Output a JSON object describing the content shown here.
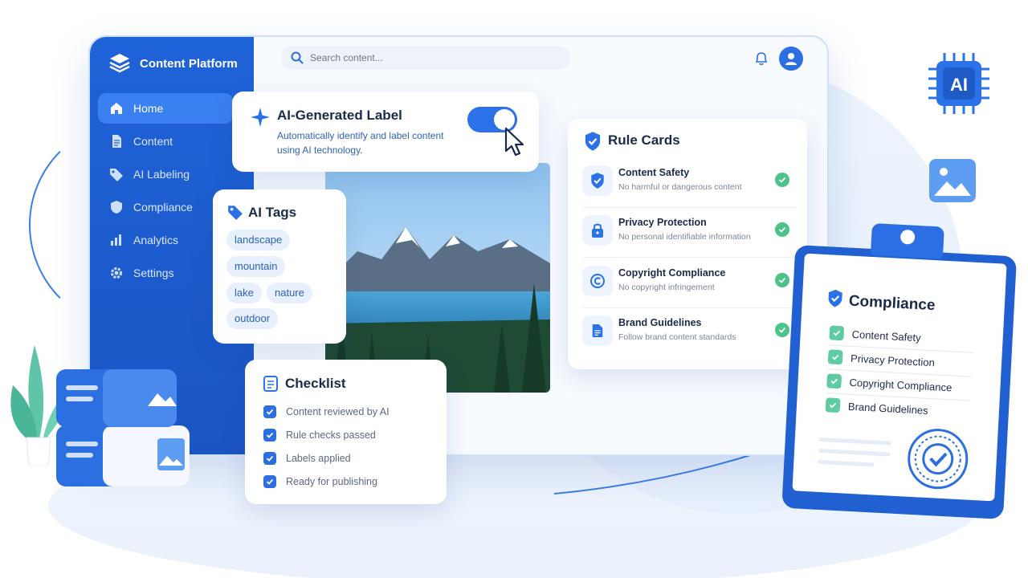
{
  "colors": {
    "primary": "#1f63d8",
    "accent": "#2b72e8",
    "success": "#4bc38a",
    "checklist_green": "#5fcba1"
  },
  "app": {
    "title": "Content Platform",
    "logo_icon": "layers-icon"
  },
  "search": {
    "placeholder": "Search content...",
    "icon": "search-icon"
  },
  "sidebar": {
    "items": [
      {
        "label": "Home",
        "icon": "home-icon",
        "active": true
      },
      {
        "label": "Content",
        "icon": "document-icon",
        "active": false
      },
      {
        "label": "AI Labeling",
        "icon": "tag-icon",
        "active": false
      },
      {
        "label": "Compliance",
        "icon": "shield-icon",
        "active": false
      },
      {
        "label": "Analytics",
        "icon": "bar-chart-icon",
        "active": false
      },
      {
        "label": "Settings",
        "icon": "gear-icon",
        "active": false
      }
    ]
  },
  "ai_label": {
    "title": "AI-Generated Label",
    "description": "Automatically identify and label content using AI technology.",
    "toggle_on": true
  },
  "ai_tags": {
    "title": "AI Tags",
    "tags": [
      "landscape",
      "mountain",
      "lake",
      "nature",
      "outdoor"
    ]
  },
  "checklist": {
    "title": "Checklist",
    "items": [
      "Content reviewed by AI",
      "Rule checks passed",
      "Labels applied",
      "Ready for publishing"
    ]
  },
  "rule_cards": {
    "title": "Rule Cards",
    "rules": [
      {
        "name": "Content Safety",
        "desc": "No harmful or dangerous content",
        "icon": "shield-check-icon"
      },
      {
        "name": "Privacy Protection",
        "desc": "No personal identifiable information",
        "icon": "lock-icon"
      },
      {
        "name": "Copyright Compliance",
        "desc": "No copyright infringement",
        "icon": "copyright-icon"
      },
      {
        "name": "Brand Guidelines",
        "desc": "Follow brand content standards",
        "icon": "document-icon"
      }
    ]
  },
  "compliance": {
    "title": "Compliance",
    "items": [
      "Content Safety",
      "Privacy Protection",
      "Copyright Compliance",
      "Brand Guidelines"
    ]
  },
  "decor": {
    "chip_label": "AI"
  }
}
